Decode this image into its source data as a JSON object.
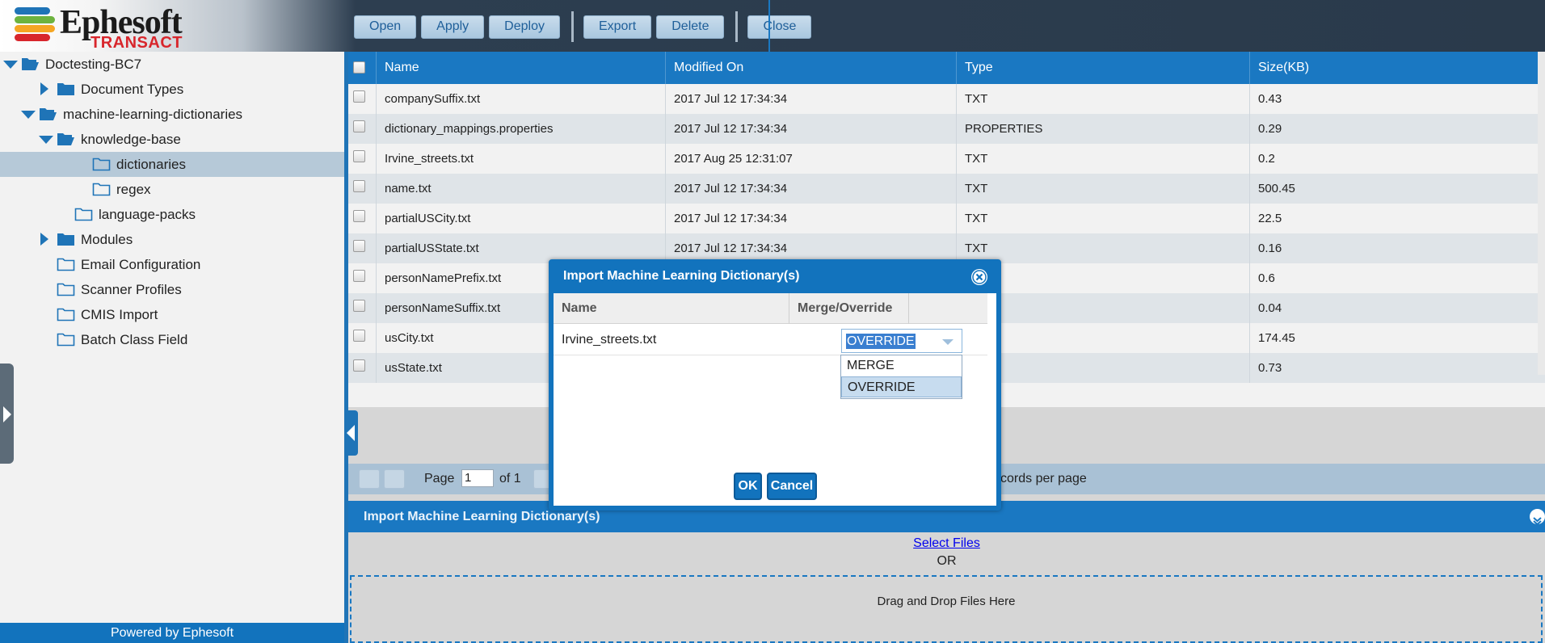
{
  "logo": {
    "word": "Ephesoft",
    "sub": "TRANSACT",
    "bar_colors": [
      "#1f74b7",
      "#6db33f",
      "#f5a623",
      "#d8262c"
    ]
  },
  "toolbar": {
    "open_label": "Open",
    "apply_label": "Apply",
    "deploy_label": "Deploy",
    "export_label": "Export",
    "delete_label": "Delete",
    "close_label": "Close"
  },
  "tree": {
    "items": [
      {
        "label": "Doctesting-BC7",
        "expander": "down",
        "folder": "open"
      },
      {
        "label": "Document Types",
        "expander": "right",
        "folder": "closed"
      },
      {
        "label": "machine-learning-dictionaries",
        "expander": "down",
        "folder": "open"
      },
      {
        "label": "knowledge-base",
        "expander": "down",
        "folder": "open"
      },
      {
        "label": "dictionaries",
        "expander": "none",
        "folder": "outline",
        "selected": true
      },
      {
        "label": "regex",
        "expander": "none",
        "folder": "outline"
      },
      {
        "label": "language-packs",
        "expander": "none",
        "folder": "outline"
      },
      {
        "label": "Modules",
        "expander": "right",
        "folder": "closed"
      },
      {
        "label": "Email Configuration",
        "expander": "none",
        "folder": "outline"
      },
      {
        "label": "Scanner Profiles",
        "expander": "none",
        "folder": "outline"
      },
      {
        "label": "CMIS Import",
        "expander": "none",
        "folder": "outline"
      },
      {
        "label": "Batch Class Field",
        "expander": "none",
        "folder": "outline"
      }
    ],
    "footer": "Powered by Ephesoft"
  },
  "grid": {
    "columns": [
      "Name",
      "Modified On",
      "Type",
      "Size(KB)"
    ],
    "rows": [
      [
        "companySuffix.txt",
        "2017 Jul 12 17:34:34",
        "TXT",
        "0.43"
      ],
      [
        "dictionary_mappings.properties",
        "2017 Jul 12 17:34:34",
        "PROPERTIES",
        "0.29"
      ],
      [
        "Irvine_streets.txt",
        "2017 Aug 25 12:31:07",
        "TXT",
        "0.2"
      ],
      [
        "name.txt",
        "2017 Jul 12 17:34:34",
        "TXT",
        "500.45"
      ],
      [
        "partialUSCity.txt",
        "2017 Jul 12 17:34:34",
        "TXT",
        "22.5"
      ],
      [
        "partialUSState.txt",
        "2017 Jul 12 17:34:34",
        "TXT",
        "0.16"
      ],
      [
        "personNamePrefix.txt",
        "",
        "",
        "0.6"
      ],
      [
        "personNameSuffix.txt",
        "",
        "",
        "0.04"
      ],
      [
        "usCity.txt",
        "",
        "",
        "174.45"
      ],
      [
        "usState.txt",
        "",
        "",
        "0.73"
      ]
    ]
  },
  "pager": {
    "page_label": "Page",
    "page_value": "1",
    "of_label": "of 1",
    "records_label": "cords per page"
  },
  "import_panel": {
    "title": "Import Machine Learning Dictionary(s)",
    "select_files": "Select Files",
    "or": "OR",
    "drop_text": "Drag and Drop Files Here"
  },
  "modal": {
    "title": "Import Machine Learning Dictionary(s)",
    "col_name": "Name",
    "col_merge": "Merge/Override",
    "row_name": "Irvine_streets.txt",
    "selected_value": "OVERRIDE",
    "options": [
      "MERGE",
      "OVERRIDE"
    ],
    "ok_label": "OK",
    "cancel_label": "Cancel"
  }
}
